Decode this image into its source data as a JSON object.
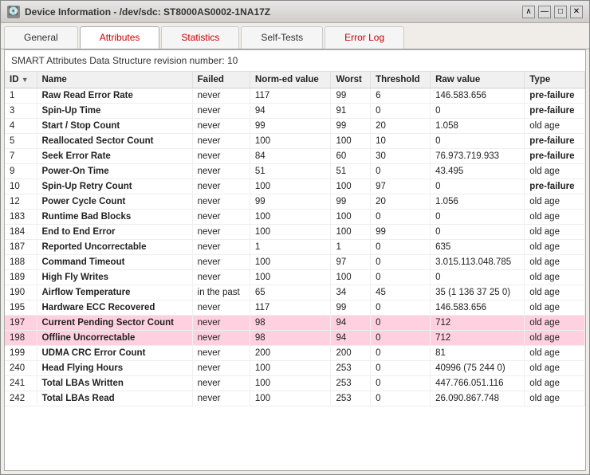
{
  "window": {
    "title": "Device Information - /dev/sdc: ST8000AS0002-1NA17Z",
    "icon": "💽"
  },
  "window_buttons": [
    "∧",
    "—",
    "□",
    "✕"
  ],
  "tabs": [
    {
      "label": "General",
      "active": false,
      "red": false
    },
    {
      "label": "Attributes",
      "active": true,
      "red": false
    },
    {
      "label": "Statistics",
      "active": false,
      "red": true
    },
    {
      "label": "Self-Tests",
      "active": false,
      "red": false
    },
    {
      "label": "Error Log",
      "active": false,
      "red": true
    }
  ],
  "smart_header": "SMART Attributes Data Structure revision number: 10",
  "columns": [
    "ID",
    "Name",
    "Failed",
    "Norm-ed value",
    "Worst",
    "Threshold",
    "Raw value",
    "Type"
  ],
  "rows": [
    {
      "id": "1",
      "name": "Raw Read Error Rate",
      "failed": "never",
      "norm": "117",
      "worst": "99",
      "thresh": "6",
      "raw": "146.583.656",
      "type": "pre-failure",
      "bold_type": true,
      "highlight": false
    },
    {
      "id": "3",
      "name": "Spin-Up Time",
      "failed": "never",
      "norm": "94",
      "worst": "91",
      "thresh": "0",
      "raw": "0",
      "type": "pre-failure",
      "bold_type": true,
      "highlight": false
    },
    {
      "id": "4",
      "name": "Start / Stop Count",
      "failed": "never",
      "norm": "99",
      "worst": "99",
      "thresh": "20",
      "raw": "1.058",
      "type": "old age",
      "bold_type": false,
      "highlight": false
    },
    {
      "id": "5",
      "name": "Reallocated Sector Count",
      "failed": "never",
      "norm": "100",
      "worst": "100",
      "thresh": "10",
      "raw": "0",
      "type": "pre-failure",
      "bold_type": true,
      "highlight": false
    },
    {
      "id": "7",
      "name": "Seek Error Rate",
      "failed": "never",
      "norm": "84",
      "worst": "60",
      "thresh": "30",
      "raw": "76.973.719.933",
      "type": "pre-failure",
      "bold_type": true,
      "highlight": false
    },
    {
      "id": "9",
      "name": "Power-On Time",
      "failed": "never",
      "norm": "51",
      "worst": "51",
      "thresh": "0",
      "raw": "43.495",
      "type": "old age",
      "bold_type": false,
      "highlight": false
    },
    {
      "id": "10",
      "name": "Spin-Up Retry Count",
      "failed": "never",
      "norm": "100",
      "worst": "100",
      "thresh": "97",
      "raw": "0",
      "type": "pre-failure",
      "bold_type": true,
      "highlight": false
    },
    {
      "id": "12",
      "name": "Power Cycle Count",
      "failed": "never",
      "norm": "99",
      "worst": "99",
      "thresh": "20",
      "raw": "1.056",
      "type": "old age",
      "bold_type": false,
      "highlight": false
    },
    {
      "id": "183",
      "name": "Runtime Bad Blocks",
      "failed": "never",
      "norm": "100",
      "worst": "100",
      "thresh": "0",
      "raw": "0",
      "type": "old age",
      "bold_type": false,
      "highlight": false
    },
    {
      "id": "184",
      "name": "End to End Error",
      "failed": "never",
      "norm": "100",
      "worst": "100",
      "thresh": "99",
      "raw": "0",
      "type": "old age",
      "bold_type": false,
      "highlight": false
    },
    {
      "id": "187",
      "name": "Reported Uncorrectable",
      "failed": "never",
      "norm": "1",
      "worst": "1",
      "thresh": "0",
      "raw": "635",
      "type": "old age",
      "bold_type": false,
      "highlight": false
    },
    {
      "id": "188",
      "name": "Command Timeout",
      "failed": "never",
      "norm": "100",
      "worst": "97",
      "thresh": "0",
      "raw": "3.015.113.048.785",
      "type": "old age",
      "bold_type": false,
      "highlight": false
    },
    {
      "id": "189",
      "name": "High Fly Writes",
      "failed": "never",
      "norm": "100",
      "worst": "100",
      "thresh": "0",
      "raw": "0",
      "type": "old age",
      "bold_type": false,
      "highlight": false
    },
    {
      "id": "190",
      "name": "Airflow Temperature",
      "failed": "in the past",
      "norm": "65",
      "worst": "34",
      "thresh": "45",
      "raw": "35 (1 136 37 25 0)",
      "type": "old age",
      "bold_type": false,
      "highlight": false
    },
    {
      "id": "195",
      "name": "Hardware ECC Recovered",
      "failed": "never",
      "norm": "117",
      "worst": "99",
      "thresh": "0",
      "raw": "146.583.656",
      "type": "old age",
      "bold_type": false,
      "highlight": false
    },
    {
      "id": "197",
      "name": "Current Pending Sector Count",
      "failed": "never",
      "norm": "98",
      "worst": "94",
      "thresh": "0",
      "raw": "712",
      "type": "old age",
      "bold_type": false,
      "highlight": true
    },
    {
      "id": "198",
      "name": "Offline Uncorrectable",
      "failed": "never",
      "norm": "98",
      "worst": "94",
      "thresh": "0",
      "raw": "712",
      "type": "old age",
      "bold_type": false,
      "highlight": true
    },
    {
      "id": "199",
      "name": "UDMA CRC Error Count",
      "failed": "never",
      "norm": "200",
      "worst": "200",
      "thresh": "0",
      "raw": "81",
      "type": "old age",
      "bold_type": false,
      "highlight": false
    },
    {
      "id": "240",
      "name": "Head Flying Hours",
      "failed": "never",
      "norm": "100",
      "worst": "253",
      "thresh": "0",
      "raw": "40996 (75 244 0)",
      "type": "old age",
      "bold_type": false,
      "highlight": false
    },
    {
      "id": "241",
      "name": "Total LBAs Written",
      "failed": "never",
      "norm": "100",
      "worst": "253",
      "thresh": "0",
      "raw": "447.766.051.116",
      "type": "old age",
      "bold_type": false,
      "highlight": false
    },
    {
      "id": "242",
      "name": "Total LBAs Read",
      "failed": "never",
      "norm": "100",
      "worst": "253",
      "thresh": "0",
      "raw": "26.090.867.748",
      "type": "old age",
      "bold_type": false,
      "highlight": false
    }
  ]
}
